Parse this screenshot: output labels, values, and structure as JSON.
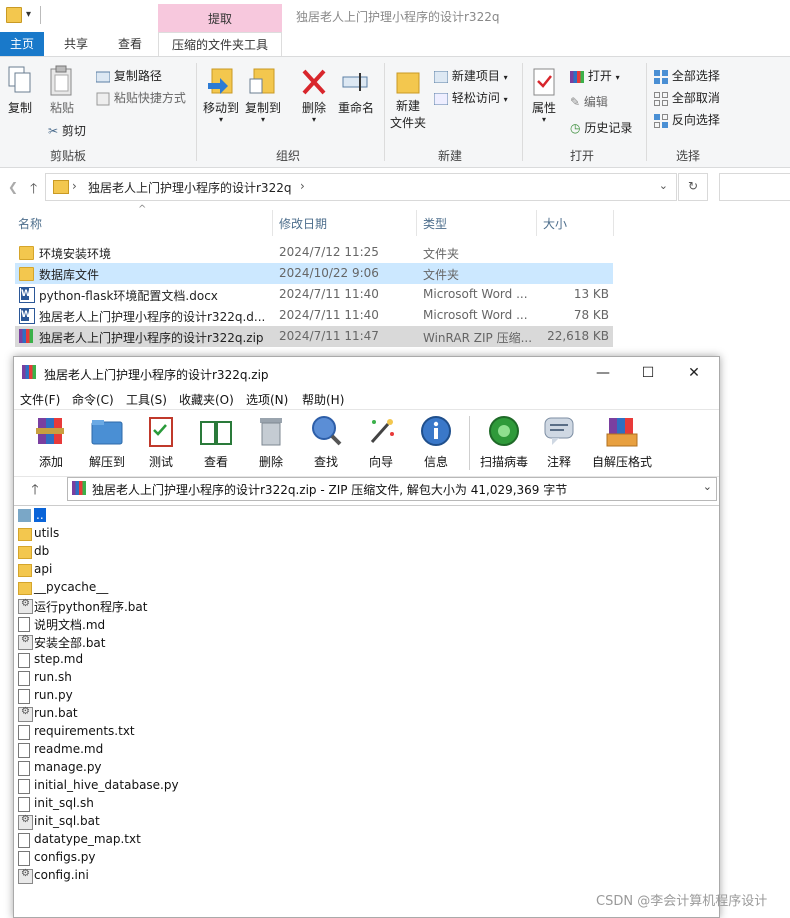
{
  "explorer": {
    "title": "独居老人上门护理小程序的设计r322q",
    "context_tab": "提取",
    "tabs": [
      {
        "label": "主页",
        "active": true
      },
      {
        "label": "共享",
        "active": false
      },
      {
        "label": "查看",
        "active": false
      },
      {
        "label": "压缩的文件夹工具",
        "active": false
      }
    ],
    "ribbon": {
      "clipboard": {
        "label": "剪贴板",
        "copy": "复制",
        "paste": "粘贴",
        "copy_path": "复制路径",
        "paste_shortcut": "粘贴快捷方式",
        "cut": "剪切"
      },
      "organize": {
        "label": "组织",
        "move_to": "移动到",
        "copy_to": "复制到",
        "delete": "删除",
        "rename": "重命名"
      },
      "new": {
        "label": "新建",
        "new_folder": "新建\n文件夹",
        "new_item": "新建项目",
        "easy_access": "轻松访问"
      },
      "open": {
        "label": "打开",
        "properties": "属性",
        "open": "打开",
        "edit": "编辑",
        "history": "历史记录"
      },
      "select": {
        "label": "选择",
        "select_all": "全部选择",
        "select_none": "全部取消",
        "invert": "反向选择"
      }
    },
    "address": {
      "path": "独居老人上门护理小程序的设计r322q"
    },
    "columns": {
      "name": "名称",
      "date": "修改日期",
      "type": "类型",
      "size": "大小"
    },
    "files": [
      {
        "name": "环境安装环境",
        "date": "2024/7/12 11:25",
        "type": "文件夹",
        "size": "",
        "icon": "folder"
      },
      {
        "name": "数据库文件",
        "date": "2024/10/22 9:06",
        "type": "文件夹",
        "size": "",
        "icon": "folder"
      },
      {
        "name": "python-flask环境配置文档.docx",
        "date": "2024/7/11 11:40",
        "type": "Microsoft Word ...",
        "size": "13 KB",
        "icon": "word"
      },
      {
        "name": "独居老人上门护理小程序的设计r322q.d...",
        "date": "2024/7/11 11:40",
        "type": "Microsoft Word ...",
        "size": "78 KB",
        "icon": "word"
      },
      {
        "name": "独居老人上门护理小程序的设计r322q.zip",
        "date": "2024/7/11 11:47",
        "type": "WinRAR ZIP 压缩...",
        "size": "22,618 KB",
        "icon": "rar"
      }
    ]
  },
  "winrar": {
    "title": "独居老人上门护理小程序的设计r322q.zip",
    "menu": [
      "文件(F)",
      "命令(C)",
      "工具(S)",
      "收藏夹(O)",
      "选项(N)",
      "帮助(H)"
    ],
    "toolbar": [
      "添加",
      "解压到",
      "测试",
      "查看",
      "删除",
      "查找",
      "向导",
      "信息",
      "扫描病毒",
      "注释",
      "自解压格式"
    ],
    "path": "独居老人上门护理小程序的设计r322q.zip - ZIP 压缩文件, 解包大小为 41,029,369 字节",
    "entries": [
      {
        "name": "..",
        "icon": "up"
      },
      {
        "name": "utils",
        "icon": "folder"
      },
      {
        "name": "db",
        "icon": "folder"
      },
      {
        "name": "api",
        "icon": "folder"
      },
      {
        "name": "__pycache__",
        "icon": "folder"
      },
      {
        "name": "运行python程序.bat",
        "icon": "bat"
      },
      {
        "name": "说明文档.md",
        "icon": "file"
      },
      {
        "name": "安装全部.bat",
        "icon": "bat"
      },
      {
        "name": "step.md",
        "icon": "file"
      },
      {
        "name": "run.sh",
        "icon": "file"
      },
      {
        "name": "run.py",
        "icon": "file"
      },
      {
        "name": "run.bat",
        "icon": "bat"
      },
      {
        "name": "requirements.txt",
        "icon": "file"
      },
      {
        "name": "readme.md",
        "icon": "file"
      },
      {
        "name": "manage.py",
        "icon": "file"
      },
      {
        "name": "initial_hive_database.py",
        "icon": "file"
      },
      {
        "name": "init_sql.sh",
        "icon": "file"
      },
      {
        "name": "init_sql.bat",
        "icon": "bat"
      },
      {
        "name": "datatype_map.txt",
        "icon": "file"
      },
      {
        "name": "configs.py",
        "icon": "file"
      },
      {
        "name": "config.ini",
        "icon": "bat"
      }
    ]
  },
  "watermark": "CSDN @李会计算机程序设计"
}
